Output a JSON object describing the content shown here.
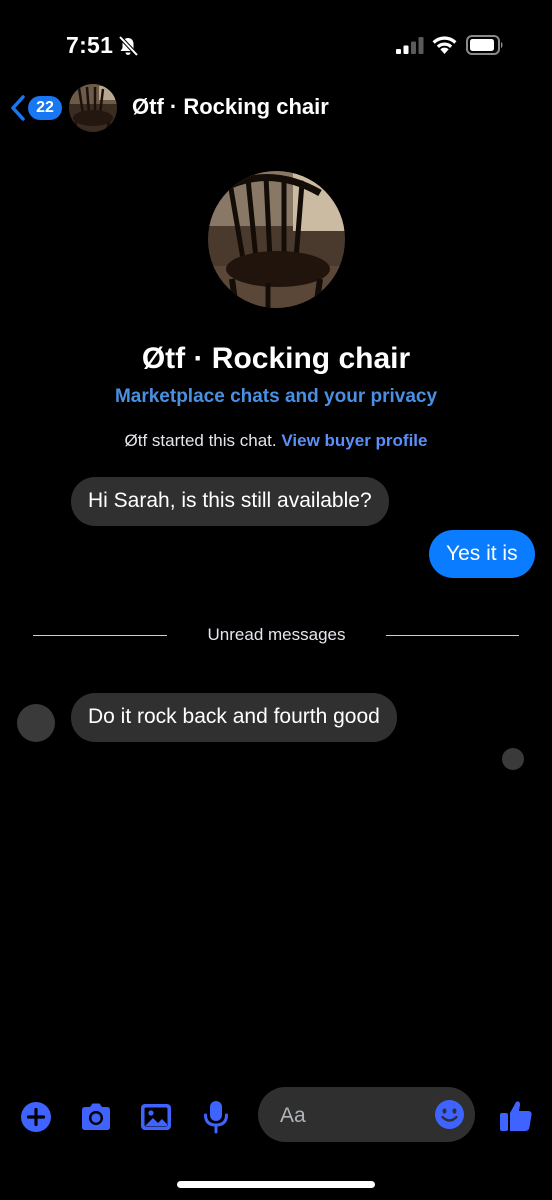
{
  "status_bar": {
    "time": "7:51",
    "icons": [
      "bell-slash-icon",
      "cellular-signal-icon",
      "wifi-icon",
      "battery-icon"
    ]
  },
  "header": {
    "back_badge_count": "22",
    "title": "Øtf · Rocking chair",
    "icons": [
      "chevron-left-icon"
    ]
  },
  "profile": {
    "name": "Øtf · Rocking chair",
    "privacy_link": "Marketplace chats and your privacy",
    "started_text": "Øtf started this chat.",
    "view_profile_link": "View buyer profile"
  },
  "messages": [
    {
      "direction": "incoming",
      "text": "Hi Sarah, is this still available?"
    },
    {
      "direction": "outgoing",
      "text": "Yes it is"
    },
    {
      "direction": "incoming",
      "text": "Do it rock back and fourth good"
    }
  ],
  "divider": {
    "label": "Unread messages"
  },
  "composer": {
    "placeholder": "Aa",
    "icons": [
      "plus-icon",
      "camera-icon",
      "gallery-icon",
      "microphone-icon",
      "smiley-icon",
      "thumbs-up-icon"
    ]
  },
  "colors": {
    "background": "#000000",
    "accent": "#1877f2",
    "outgoing_bubble": "#0a7cff",
    "incoming_bubble": "#303030",
    "link": "#4a90e2",
    "composer_icon": "#3f63ff"
  }
}
